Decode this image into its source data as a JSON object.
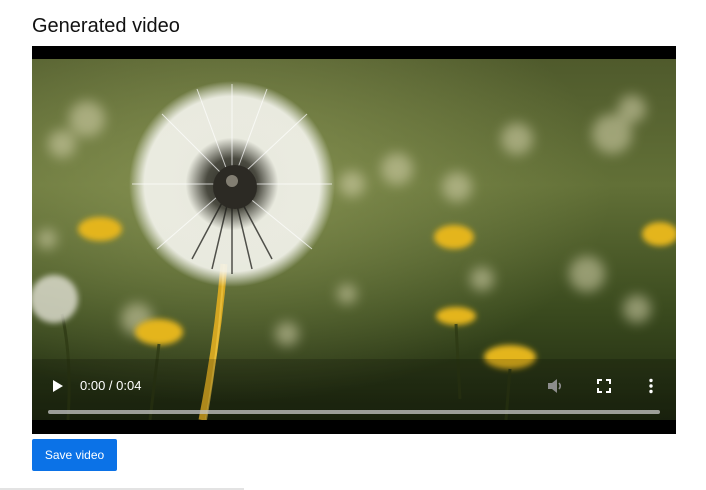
{
  "page": {
    "title": "Generated video"
  },
  "video": {
    "current_time": "0:00",
    "duration": "0:04",
    "time_display": "0:00 / 0:04",
    "progress": 0
  },
  "actions": {
    "save_label": "Save video"
  },
  "colors": {
    "accent": "#0b72e7",
    "player_background": "#000000"
  },
  "icons": [
    "play-icon",
    "volume-icon",
    "fullscreen-icon",
    "more-options-icon"
  ]
}
